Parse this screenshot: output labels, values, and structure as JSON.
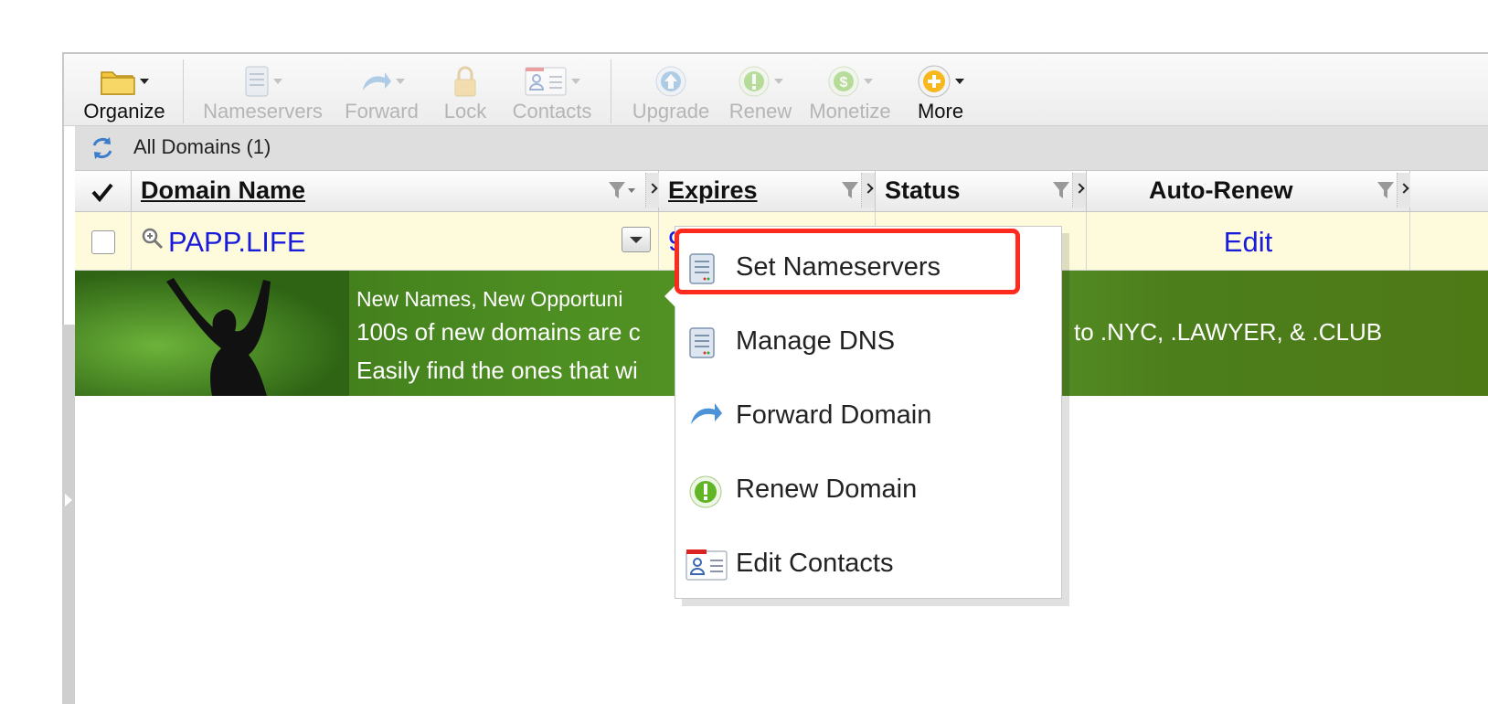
{
  "toolbar": {
    "organize": "Organize",
    "nameservers": "Nameservers",
    "forward": "Forward",
    "lock": "Lock",
    "contacts": "Contacts",
    "upgrade": "Upgrade",
    "renew": "Renew",
    "monetize": "Monetize",
    "more": "More"
  },
  "statusbar": {
    "text": "All Domains (1)"
  },
  "grid": {
    "columns": {
      "domain_name": "Domain Name",
      "expires": "Expires",
      "status": "Status",
      "auto_renew": "Auto-Renew"
    },
    "rows": [
      {
        "domain": "PAPP.LIFE",
        "expires_fragment": "9",
        "auto_renew": "Edit"
      }
    ]
  },
  "banner": {
    "line1": "New Names, New Opportuni",
    "line2_left": "100s of new domains are c",
    "line2_right": "to .NYC, .LAWYER, & .CLUB",
    "line3": "Easily find the ones that wi"
  },
  "context_menu": {
    "items": [
      {
        "label": "Set Nameservers",
        "icon": "nameservers-icon",
        "highlighted": true
      },
      {
        "label": "Manage DNS",
        "icon": "dns-icon"
      },
      {
        "label": "Forward Domain",
        "icon": "forward-icon"
      },
      {
        "label": "Renew Domain",
        "icon": "renew-icon"
      },
      {
        "label": "Edit Contacts",
        "icon": "contacts-icon"
      }
    ]
  },
  "colors": {
    "highlight": "#ff2a1e",
    "link": "#1a1adb",
    "row_bg": "#fdfbdc",
    "banner_green": "#4e8f22"
  }
}
